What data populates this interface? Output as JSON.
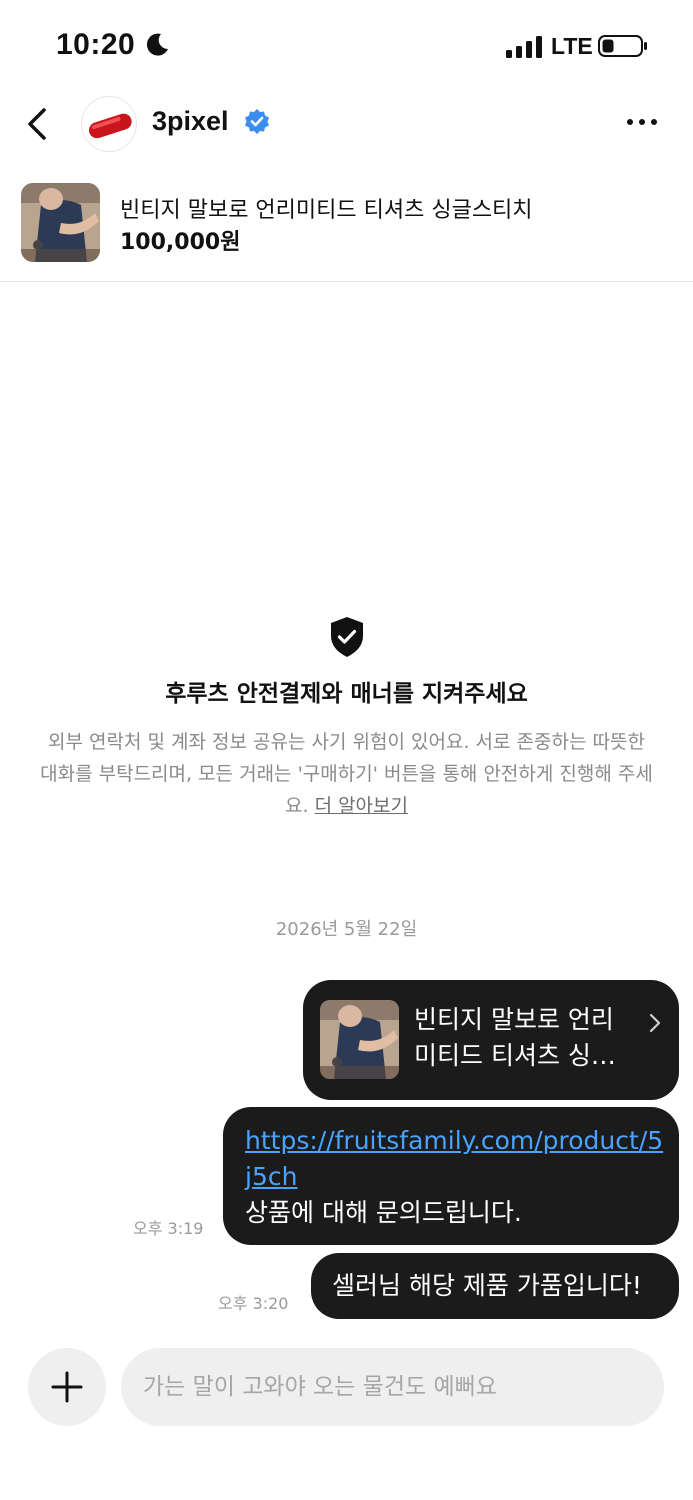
{
  "status_bar": {
    "time": "10:20",
    "network": "LTE",
    "icons": [
      "moon-icon",
      "signal-icon",
      "battery-icon"
    ]
  },
  "header": {
    "name": "3pixel",
    "verified": true,
    "icons": [
      "back-arrow-icon",
      "pill-avatar",
      "verified-badge-icon",
      "more-dots-icon"
    ]
  },
  "product": {
    "title": "빈티지 말보로 언리미티드 티셔츠 싱글스티치",
    "price": "100,000원"
  },
  "notice": {
    "title": "후루츠 안전결제와 매너를 지켜주세요",
    "body": "외부 연락처 및 계좌 정보 공유는 사기 위험이 있어요. 서로 존중하는 따뜻한 대화를 부탁드리며, 모든 거래는 '구매하기' 버튼을 통해 안전하게 진행해 주세요.",
    "link": "더 알아보기"
  },
  "chat": {
    "date": "2026년 5월 22일",
    "messages": [
      {
        "type": "product",
        "text": "빈티지 말보로 언리미티드 티셔츠 싱…"
      },
      {
        "type": "link",
        "url": "https://fruitsfamily.com/product/5j5ch",
        "text": "상품에 대해 문의드립니다.",
        "time": "오후 3:19"
      },
      {
        "type": "text",
        "text": "셀러님 해당 제품 가품입니다!",
        "time": "오후 3:20"
      }
    ]
  },
  "composer": {
    "placeholder": "가는 말이 고와야 오는 물건도 예뻐요"
  },
  "colors": {
    "bubble": "#1b1b1b",
    "link": "#4aa3ff",
    "verified": "#3b8ef0",
    "muted": "#9a9a9a",
    "input_bg": "#efefef"
  }
}
